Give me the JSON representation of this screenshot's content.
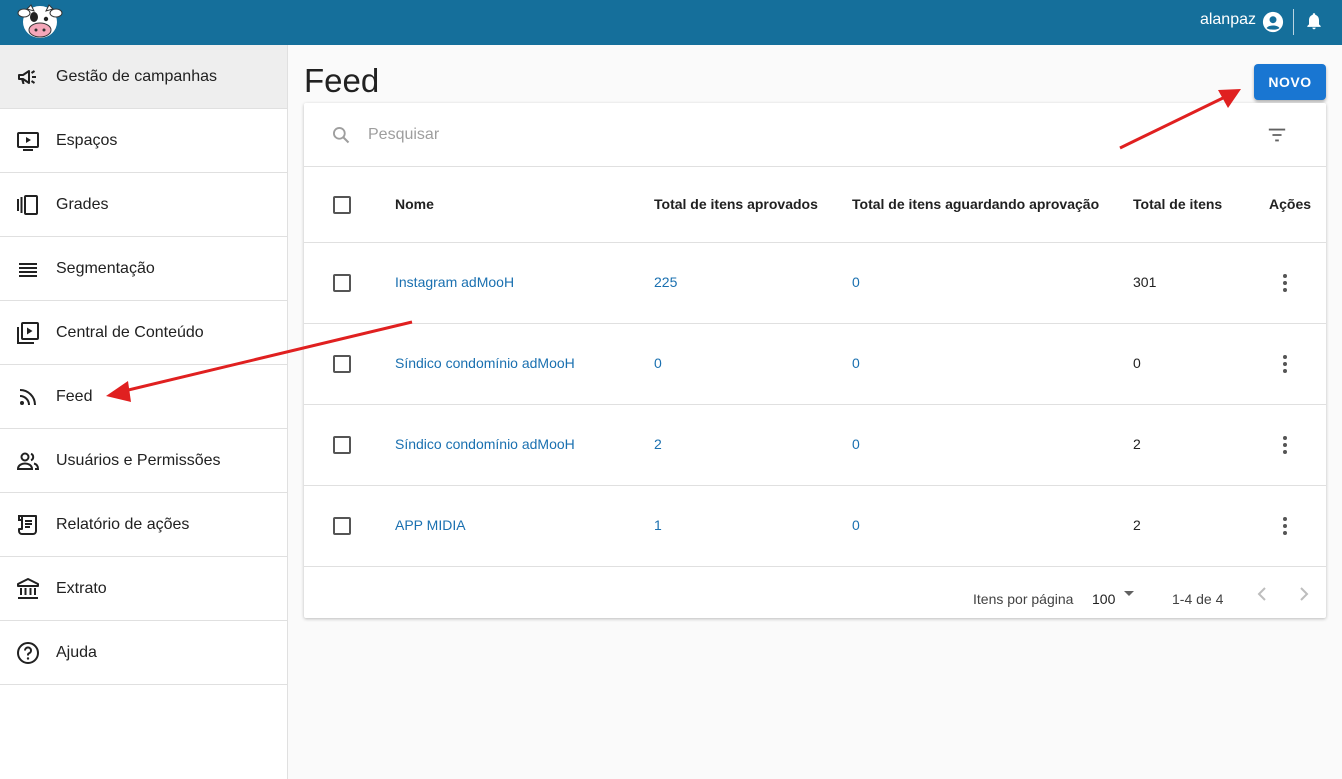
{
  "header": {
    "username": "alanpaz",
    "bg_color": "#156f9b",
    "icons": [
      "cow-logo-icon",
      "account-circle-icon",
      "bell-icon"
    ]
  },
  "sidebar": {
    "items": [
      {
        "label": "Gestão de campanhas",
        "icon": "megaphone-icon",
        "active": true
      },
      {
        "label": "Espaços",
        "icon": "screen-play-icon"
      },
      {
        "label": "Grades",
        "icon": "carousel-icon"
      },
      {
        "label": "Segmentação",
        "icon": "list-lines-icon"
      },
      {
        "label": "Central de Conteúdo",
        "icon": "video-library-icon"
      },
      {
        "label": "Feed",
        "icon": "rss-feed-icon"
      },
      {
        "label": "Usuários e Permissões",
        "icon": "people-icon"
      },
      {
        "label": "Relatório de ações",
        "icon": "scroll-report-icon"
      },
      {
        "label": "Extrato",
        "icon": "bank-icon"
      },
      {
        "label": "Ajuda",
        "icon": "help-circle-icon"
      }
    ]
  },
  "main": {
    "title": "Feed",
    "new_button_label": "NOVO",
    "search_placeholder": "Pesquisar",
    "columns": [
      "Nome",
      "Total de itens aprovados",
      "Total de itens aguardando aprovação",
      "Total de itens",
      "Ações"
    ],
    "rows": [
      {
        "nome": "Instagram adMooH",
        "aprovados": "225",
        "aguardando": "0",
        "total": "301"
      },
      {
        "nome": "Síndico condomínio adMooH",
        "aprovados": "0",
        "aguardando": "0",
        "total": "0"
      },
      {
        "nome": "Síndico condomínio adMooH",
        "aprovados": "2",
        "aguardando": "0",
        "total": "2"
      },
      {
        "nome": "APP MIDIA",
        "aprovados": "1",
        "aguardando": "0",
        "total": "2"
      }
    ],
    "pagination": {
      "rows_per_page_label": "Itens por página",
      "rows_per_page": "100",
      "range": "1-4 de 4"
    }
  },
  "colors": {
    "primary": "#1976d2",
    "link": "#1a70b0",
    "annotation_arrow": "#e02020"
  }
}
